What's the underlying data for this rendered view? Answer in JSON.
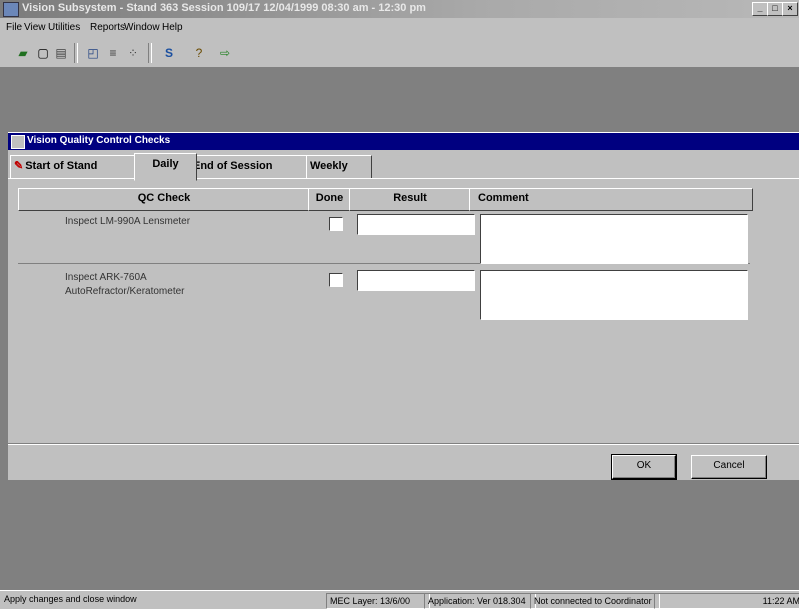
{
  "app": {
    "title": "Vision Subsystem - Stand 363 Session 109/17 12/04/1999 08:30 am - 12:30 pm"
  },
  "menu": [
    "File",
    "View",
    "Utilities",
    "Reports",
    "Window",
    "Help"
  ],
  "toolbar": {
    "icons": [
      "save-icon",
      "new-icon",
      "print-icon",
      "window-icon",
      "list-icon",
      "text-icon",
      "tool-icon",
      "help-icon",
      "exit-icon"
    ]
  },
  "dialog": {
    "title": "Vision Quality Control Checks",
    "tabs": [
      {
        "label": "Start of Stand",
        "active": false,
        "icon": "pencil-icon"
      },
      {
        "label": "Daily",
        "active": true
      },
      {
        "label": "End of Session",
        "active": false
      },
      {
        "label": "Weekly",
        "active": false
      }
    ],
    "columns": {
      "qc_check": "QC Check",
      "done": "Done",
      "result": "Result",
      "comment": "Comment"
    },
    "rows": [
      {
        "check": "Inspect LM-990A Lensmeter",
        "done": false,
        "result": "",
        "comment": ""
      },
      {
        "check": "Inspect ARK-760A AutoRefractor/Keratometer",
        "done": false,
        "result": "",
        "comment": ""
      }
    ],
    "buttons": {
      "ok": "OK",
      "cancel": "Cancel"
    }
  },
  "statusbar": {
    "message": "Apply changes and close window",
    "mec_layer": "MEC Layer: 13/6/00",
    "app_version": "Application: Ver 018.304",
    "connection": "Not connected to Coordinator",
    "time": "11:22 AM"
  }
}
